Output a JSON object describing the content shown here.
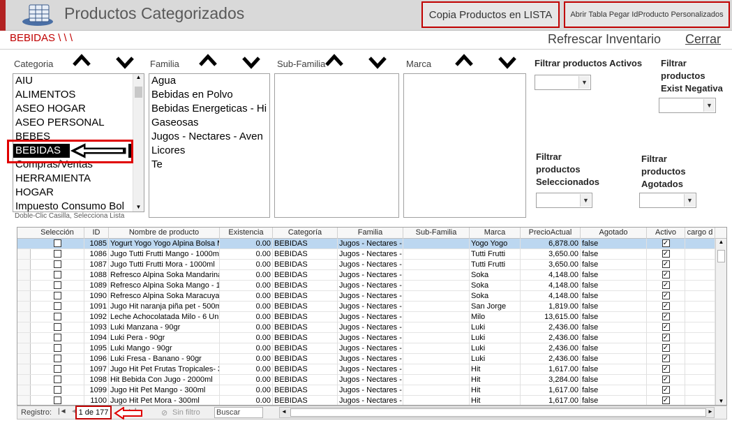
{
  "header": {
    "title": "Productos Categorizados",
    "copia_label": "Copia Productos en LISTA",
    "abrir_label": "Abrir Tabla Pegar IdProducto Personalizados"
  },
  "breadcrumb": "BEBIDAS \\ \\ \\",
  "actions": {
    "refrescar": "Refrescar Inventario",
    "cerrar": "Cerrar"
  },
  "filters": {
    "categoria_label": "Categoria",
    "familia_label": "Familia",
    "subfamilia_label": "Sub-Familia",
    "marca_label": "Marca",
    "categorias": [
      "AIU",
      "ALIMENTOS",
      "ASEO HOGAR",
      "ASEO PERSONAL",
      "BEBES",
      "BEBIDAS",
      "Compras/Ventas",
      "HERRAMIENTA",
      "HOGAR",
      "Impuesto Consumo Bol"
    ],
    "categoria_selected_index": 5,
    "familias": [
      "Agua",
      "Bebidas en Polvo",
      "Bebidas Energeticas - Hi",
      "Gaseosas",
      "Jugos - Nectares - Aven",
      "Licores",
      "Te"
    ],
    "activos_label": "Filtrar productos Activos",
    "exist_neg_label": "Filtrar productos Exist Negativa",
    "seleccionados_label": "Filtrar productos Seleccionados",
    "agotados_label": "Filtrar productos Agotados",
    "hint": "Doble-Clic Casilla, Selecciona Lista"
  },
  "grid": {
    "headers": [
      "Selección",
      "ID",
      "Nombre de producto",
      "Existencia",
      "Categoría",
      "Familia",
      "Sub-Familia",
      "Marca",
      "PrecioActual",
      "Agotado",
      "Activo",
      "cargo d"
    ],
    "rows": [
      {
        "id": "1085",
        "nombre": "Yogurt Yogo Yogo Alpina Bolsa M",
        "existencia": "0.00",
        "categoria": "BEBIDAS",
        "familia": "Jugos - Nectares -",
        "subfamilia": "",
        "marca": "Yogo Yogo",
        "precio": "6,878.00",
        "agotado": "false",
        "activo": "✓"
      },
      {
        "id": "1086",
        "nombre": "Jugo Tutti Frutti Mango - 1000ml",
        "existencia": "0.00",
        "categoria": "BEBIDAS",
        "familia": "Jugos - Nectares -",
        "subfamilia": "",
        "marca": "Tutti Frutti",
        "precio": "3,650.00",
        "agotado": "false",
        "activo": "✓"
      },
      {
        "id": "1087",
        "nombre": "Jugo Tutti Frutti Mora - 1000ml",
        "existencia": "0.00",
        "categoria": "BEBIDAS",
        "familia": "Jugos - Nectares -",
        "subfamilia": "",
        "marca": "Tutti Frutti",
        "precio": "3,650.00",
        "agotado": "false",
        "activo": "✓"
      },
      {
        "id": "1088",
        "nombre": "Refresco Alpina Soka Mandarina",
        "existencia": "0.00",
        "categoria": "BEBIDAS",
        "familia": "Jugos - Nectares -",
        "subfamilia": "",
        "marca": "Soka",
        "precio": "4,148.00",
        "agotado": "false",
        "activo": "✓"
      },
      {
        "id": "1089",
        "nombre": "Refresco Alpina Soka Mango - 1(",
        "existencia": "0.00",
        "categoria": "BEBIDAS",
        "familia": "Jugos - Nectares -",
        "subfamilia": "",
        "marca": "Soka",
        "precio": "4,148.00",
        "agotado": "false",
        "activo": "✓"
      },
      {
        "id": "1090",
        "nombre": "Refresco Alpina Soka Maracuya",
        "existencia": "0.00",
        "categoria": "BEBIDAS",
        "familia": "Jugos - Nectares -",
        "subfamilia": "",
        "marca": "Soka",
        "precio": "4,148.00",
        "agotado": "false",
        "activo": "✓"
      },
      {
        "id": "1091",
        "nombre": "Jugo Hit naranja piña pet - 500ml",
        "existencia": "0.00",
        "categoria": "BEBIDAS",
        "familia": "Jugos - Nectares -",
        "subfamilia": "",
        "marca": "San Jorge",
        "precio": "1,819.00",
        "agotado": "false",
        "activo": "✓"
      },
      {
        "id": "1092",
        "nombre": "Leche Achocolatada Milo - 6 Unid",
        "existencia": "0.00",
        "categoria": "BEBIDAS",
        "familia": "Jugos - Nectares -",
        "subfamilia": "",
        "marca": "Milo",
        "precio": "13,615.00",
        "agotado": "false",
        "activo": "✓"
      },
      {
        "id": "1093",
        "nombre": "Luki Manzana - 90gr",
        "existencia": "0.00",
        "categoria": "BEBIDAS",
        "familia": "Jugos - Nectares -",
        "subfamilia": "",
        "marca": "Luki",
        "precio": "2,436.00",
        "agotado": "false",
        "activo": "✓"
      },
      {
        "id": "1094",
        "nombre": "Luki Pera - 90gr",
        "existencia": "0.00",
        "categoria": "BEBIDAS",
        "familia": "Jugos - Nectares -",
        "subfamilia": "",
        "marca": "Luki",
        "precio": "2,436.00",
        "agotado": "false",
        "activo": "✓"
      },
      {
        "id": "1095",
        "nombre": "Luki Mango - 90gr",
        "existencia": "0.00",
        "categoria": "BEBIDAS",
        "familia": "Jugos - Nectares -",
        "subfamilia": "",
        "marca": "Luki",
        "precio": "2,436.00",
        "agotado": "false",
        "activo": "✓"
      },
      {
        "id": "1096",
        "nombre": "Luki Fresa - Banano - 90gr",
        "existencia": "0.00",
        "categoria": "BEBIDAS",
        "familia": "Jugos - Nectares -",
        "subfamilia": "",
        "marca": "Luki",
        "precio": "2,436.00",
        "agotado": "false",
        "activo": "✓"
      },
      {
        "id": "1097",
        "nombre": "Jugo Hit Pet Frutas Tropicales- 30",
        "existencia": "0.00",
        "categoria": "BEBIDAS",
        "familia": "Jugos - Nectares -",
        "subfamilia": "",
        "marca": "Hit",
        "precio": "1,617.00",
        "agotado": "false",
        "activo": "✓"
      },
      {
        "id": "1098",
        "nombre": "Hit Bebida Con Jugo - 2000ml",
        "existencia": "0.00",
        "categoria": "BEBIDAS",
        "familia": "Jugos - Nectares -",
        "subfamilia": "",
        "marca": "Hit",
        "precio": "3,284.00",
        "agotado": "false",
        "activo": "✓"
      },
      {
        "id": "1099",
        "nombre": "Jugo Hit Pet Mango - 300ml",
        "existencia": "0.00",
        "categoria": "BEBIDAS",
        "familia": "Jugos - Nectares -",
        "subfamilia": "",
        "marca": "Hit",
        "precio": "1,617.00",
        "agotado": "false",
        "activo": "✓"
      },
      {
        "id": "1100",
        "nombre": "Jugo Hit Pet Mora - 300ml",
        "existencia": "0.00",
        "categoria": "BEBIDAS",
        "familia": "Jugos - Nectares -",
        "subfamilia": "",
        "marca": "Hit",
        "precio": "1,617.00",
        "agotado": "false",
        "activo": "✓"
      }
    ]
  },
  "nav": {
    "registro_label": "Registro:",
    "page_info": "1 de 177",
    "sin_filtro": "Sin filtro",
    "buscar": "Buscar"
  },
  "colors": {
    "accent_red": "#c00000",
    "selected_row": "#bcd7f0"
  }
}
